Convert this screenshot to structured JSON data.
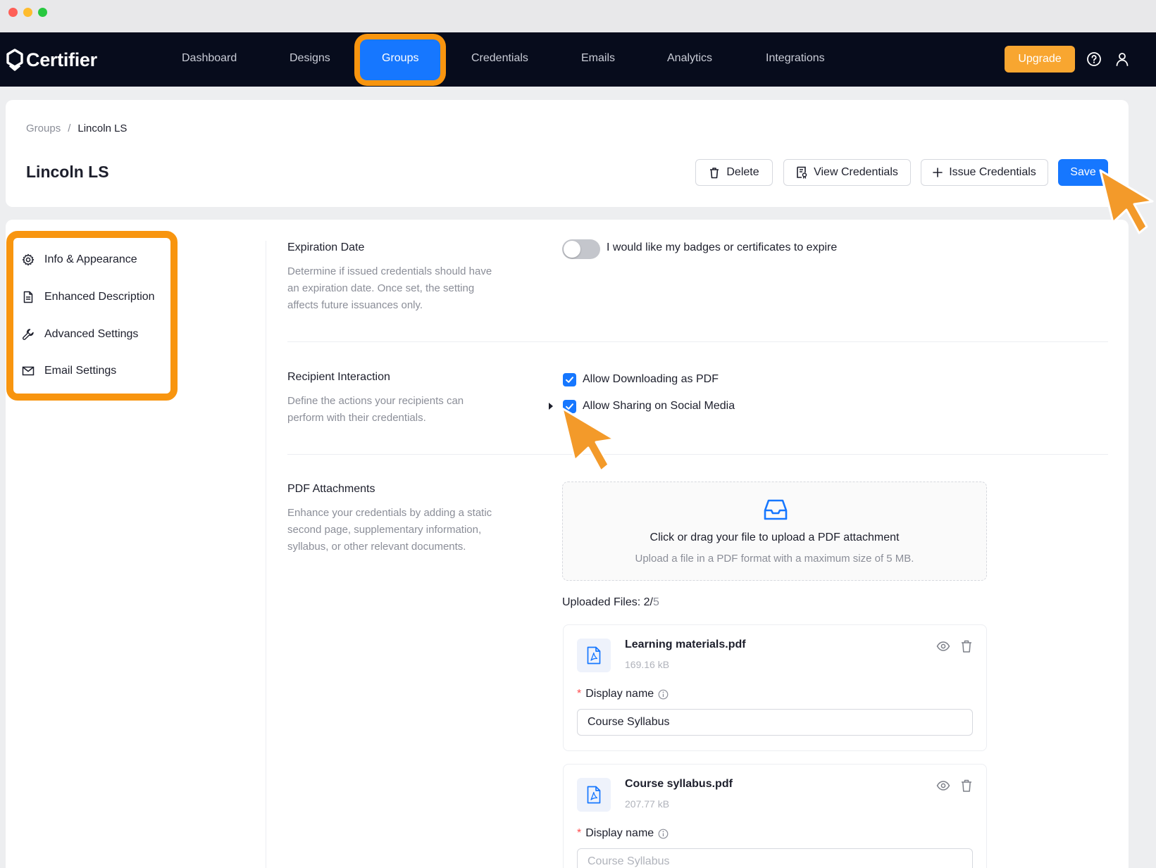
{
  "app": {
    "brand": "Certifier"
  },
  "nav": {
    "items": [
      "Dashboard",
      "Designs",
      "Groups",
      "Credentials",
      "Emails",
      "Analytics",
      "Integrations"
    ],
    "active": "Groups",
    "upgrade_label": "Upgrade"
  },
  "breadcrumb": {
    "parent": "Groups",
    "separator": "/",
    "current": "Lincoln LS"
  },
  "page": {
    "title": "Lincoln LS",
    "actions": {
      "delete": "Delete",
      "view": "View Credentials",
      "issue": "Issue Credentials",
      "save": "Save"
    }
  },
  "sidebar": {
    "items": [
      {
        "label": "Info & Appearance",
        "icon": "gear-icon"
      },
      {
        "label": "Enhanced Description",
        "icon": "document-icon"
      },
      {
        "label": "Advanced Settings",
        "icon": "wrench-icon"
      },
      {
        "label": "Email Settings",
        "icon": "envelope-icon"
      }
    ]
  },
  "sections": {
    "expiration": {
      "title": "Expiration Date",
      "desc_lines": [
        "Determine if issued credentials should have",
        "an expiration date. Once set, the setting",
        "affects future issuances only."
      ],
      "toggle_label": "I would like my badges or certificates to expire",
      "toggle_on": false
    },
    "recipient": {
      "title": "Recipient Interaction",
      "desc_lines": [
        "Define the actions your recipients can",
        "perform with their credentials."
      ],
      "options": [
        {
          "label": "Allow Downloading as PDF",
          "checked": true
        },
        {
          "label": "Allow Sharing on Social Media",
          "checked": true
        }
      ]
    },
    "pdf": {
      "title": "PDF Attachments",
      "desc_lines": [
        "Enhance your credentials by adding a static",
        "second page, supplementary information,",
        "syllabus, or other relevant documents."
      ],
      "upload_title": "Click or drag your file to upload a PDF attachment",
      "upload_sub": "Upload a file in a PDF format with a maximum size of 5 MB.",
      "uploaded_label": "Uploaded Files: 2/",
      "uploaded_max": "5",
      "files": [
        {
          "name": "Learning materials.pdf",
          "size": "169.16 kB",
          "display_label": "Display name",
          "display_value": "Course Syllabus"
        },
        {
          "name": "Course syllabus.pdf",
          "size": "207.77 kB",
          "display_label": "Display name",
          "display_placeholder": "Course Syllabus"
        }
      ]
    }
  },
  "colors": {
    "nav_bg": "#070c1c",
    "primary": "#1677ff",
    "highlight": "#f8950f",
    "upgrade": "#f8a630"
  }
}
